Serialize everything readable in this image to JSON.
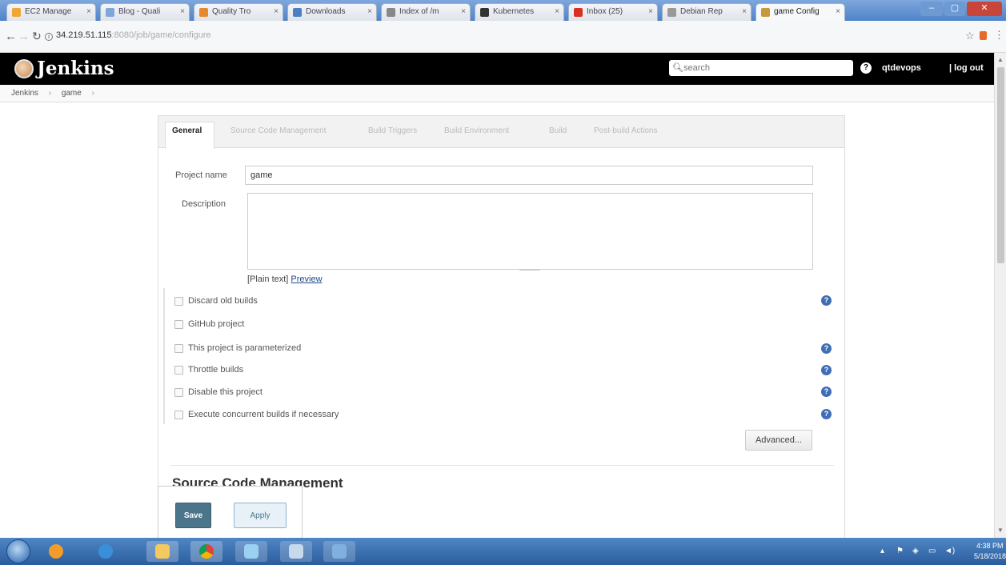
{
  "browser": {
    "tabs": [
      {
        "label": "EC2 Manage",
        "color": "#f2a531"
      },
      {
        "label": "Blog - Quali",
        "color": "#7fa6d9"
      },
      {
        "label": "Quality Tro",
        "color": "#e58a2c"
      },
      {
        "label": "Downloads",
        "color": "#4a7fc1"
      },
      {
        "label": "Index of /m",
        "color": "#888888"
      },
      {
        "label": "Kubernetes",
        "color": "#333333"
      },
      {
        "label": "Inbox (25)",
        "color": "#d93025"
      },
      {
        "label": "Debian Rep",
        "color": "#999999"
      },
      {
        "label": "game Config",
        "color": "#c69a3a"
      }
    ],
    "url_host": "34.219.51.115",
    "url_rest": ":8080/job/game/configure",
    "star_icon": "star-icon",
    "menu_icon": "kebab-menu-icon"
  },
  "header": {
    "title": "Jenkins",
    "search_placeholder": "search",
    "help": "?",
    "user": "qtdevops",
    "logout": "| log out"
  },
  "breadcrumb": {
    "items": [
      "Jenkins",
      "game"
    ],
    "sep": "›"
  },
  "config_tabs": [
    "General",
    "Source Code Management",
    "Build Triggers",
    "Build Environment",
    "Build",
    "Post-build Actions"
  ],
  "general": {
    "project_name_label": "Project name",
    "project_name_value": "game",
    "description_label": "Description",
    "format_text": "[Plain text]",
    "preview_link": "Preview",
    "options": [
      {
        "label": "Discard old builds",
        "help": true
      },
      {
        "label": "GitHub project",
        "help": false
      },
      {
        "label": "This project is parameterized",
        "help": true
      },
      {
        "label": "Throttle builds",
        "help": true
      },
      {
        "label": "Disable this project",
        "help": true
      },
      {
        "label": "Execute concurrent builds if necessary",
        "help": true
      }
    ],
    "advanced_label": "Advanced..."
  },
  "scm": {
    "title": "Source Code Management"
  },
  "buttons": {
    "save": "Save",
    "apply": "Apply"
  },
  "taskbar": {
    "time": "4:38 PM",
    "date": "5/18/2018"
  }
}
